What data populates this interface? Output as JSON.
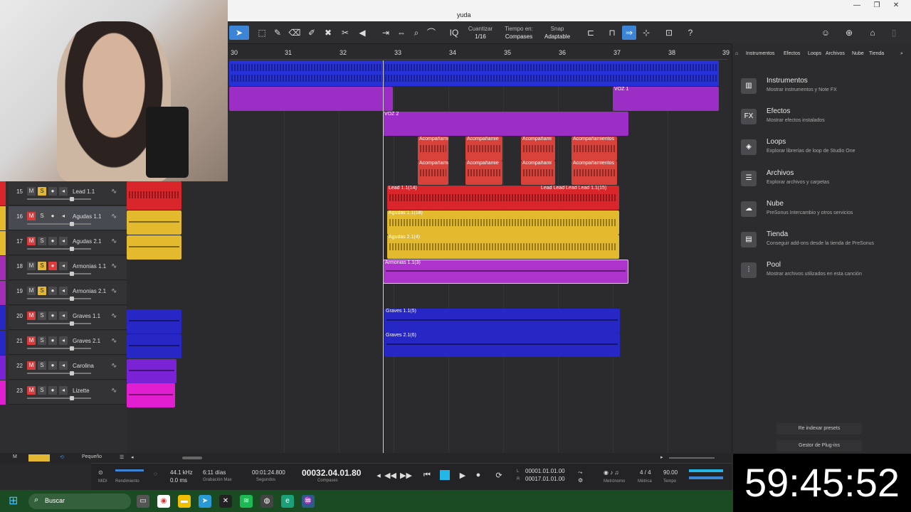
{
  "menu": {
    "fragment": "yuda"
  },
  "toolbar": {
    "quantize_label": "Cuantizar",
    "quantize_value": "1/16",
    "time_label": "Tiempo en:",
    "time_value": "Compases",
    "snap_label": "Snap",
    "snap_value": "Adaptable",
    "help": "?"
  },
  "ruler": {
    "bars": [
      "30",
      "31",
      "32",
      "33",
      "34",
      "35",
      "36",
      "37",
      "38",
      "39"
    ]
  },
  "tracks": [
    {
      "num": "15",
      "name": "Lead 1.1",
      "color": "#d8262b"
    },
    {
      "num": "16",
      "name": "Agudas 1.1",
      "color": "#e3b92e"
    },
    {
      "num": "17",
      "name": "Agudas 2.1",
      "color": "#e3b92e"
    },
    {
      "num": "18",
      "name": "Armonias 1.1",
      "color": "#a02db3"
    },
    {
      "num": "19",
      "name": "Armonias 2.1",
      "color": "#a02db3"
    },
    {
      "num": "20",
      "name": "Graves 1.1",
      "color": "#2627c4"
    },
    {
      "num": "21",
      "name": "Graves 2.1",
      "color": "#2627c4"
    },
    {
      "num": "22",
      "name": "Carolina",
      "color": "#7a22d6"
    },
    {
      "num": "23",
      "name": "Lizette",
      "color": "#e21ed1"
    }
  ],
  "track_buttons": {
    "mute": "M",
    "solo": "S"
  },
  "clips": {
    "voz1": "VOZ 1",
    "voz2": "VOZ 2",
    "acomp": [
      "Acompañami",
      "Acompañamie",
      "Acompañami",
      "Acompañamientos"
    ],
    "lead_a": "Lead 1.1(14)",
    "lead_b": "Lead Lead  Lead Lead 1.1(15)",
    "agudas1": "Agudas 1.1(18)",
    "agudas2": "Agudas 2.1(4)",
    "armonias": "Armonias 1.1(3)",
    "graves1": "Graves 1.1(5)",
    "graves2": "Graves 2.1(6)"
  },
  "lowerbar": {
    "m": "M",
    "size": "Pequeño"
  },
  "browser": {
    "tabs": [
      "Instrumentos",
      "Efectos",
      "Loops",
      "Archivos",
      "Nube",
      "Tienda"
    ],
    "items": [
      {
        "title": "Instrumentos",
        "sub": "Mostrar instrumentos y Note FX",
        "icon": "▥"
      },
      {
        "title": "Efectos",
        "sub": "Mostrar efectos instalados",
        "icon": "FX"
      },
      {
        "title": "Loops",
        "sub": "Explorar librerías de loop de Studio One",
        "icon": "◈"
      },
      {
        "title": "Archivos",
        "sub": "Explorar archivos y carpetas",
        "icon": "☰"
      },
      {
        "title": "Nube",
        "sub": "PreSonus Intercambio y otros servicios",
        "icon": "☁"
      },
      {
        "title": "Tienda",
        "sub": "Conseguir add-ons desde la tienda de PreSonus",
        "icon": "▤"
      },
      {
        "title": "Pool",
        "sub": "Mostrar archivos utilizados en esta canción",
        "icon": "⫶"
      }
    ],
    "reindex": "Re indexar presets",
    "plugin_manager": "Gestor de Plug-ins"
  },
  "transport": {
    "midi": "MIDI",
    "performance": "Rendimiento",
    "sample_rate": "44.1 kHz",
    "latency": "0.0 ms",
    "record_days": "6:11 días",
    "record_max": "Grabación Max",
    "seconds_value": "00:01:24.800",
    "seconds_label": "Segundos",
    "position": "00032.04.01.80",
    "position_label": "Compases",
    "loop_l": "00001.01.01.00",
    "loop_r": "00017.01.01.00",
    "loop_l_label": "L",
    "loop_r_label": "R",
    "metronome": "Metrónomo",
    "signature": "4 / 4",
    "signature_label": "Métrica",
    "tempo": "90.00",
    "tempo_label": "Tempo"
  },
  "timer": "59:45:52",
  "taskbar": {
    "search": "Buscar"
  }
}
